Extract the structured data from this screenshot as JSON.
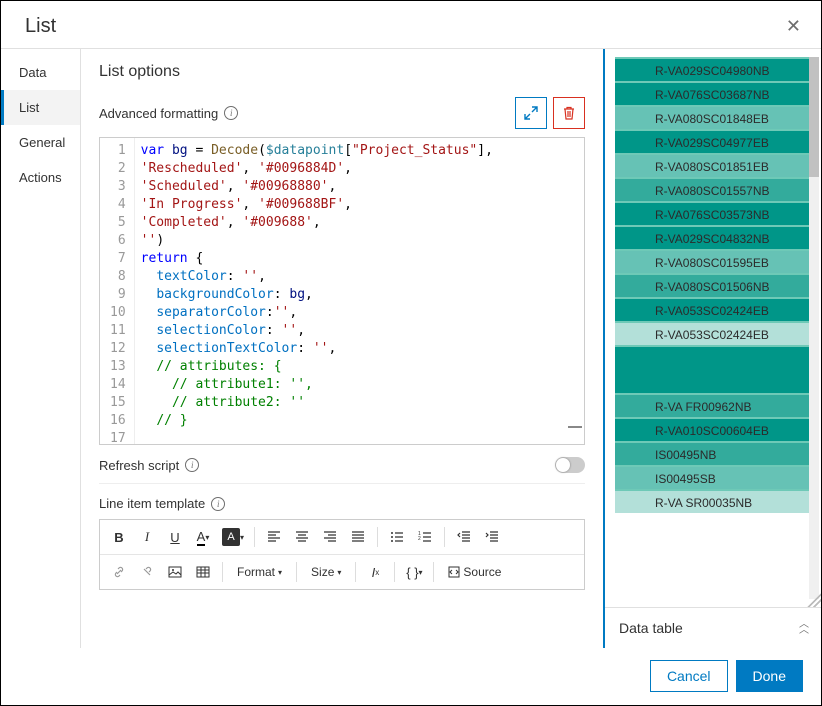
{
  "header": {
    "title": "List"
  },
  "sidebar": {
    "items": [
      {
        "label": "Data",
        "active": false
      },
      {
        "label": "List",
        "active": true
      },
      {
        "label": "General",
        "active": false
      },
      {
        "label": "Actions",
        "active": false
      }
    ]
  },
  "main": {
    "title": "List options",
    "advanced_label": "Advanced formatting",
    "refresh_label": "Refresh script",
    "refresh_on": false,
    "template_label": "Line item template",
    "toolbar": {
      "format_label": "Format",
      "size_label": "Size",
      "source_label": "Source"
    },
    "code": {
      "lines": [
        "var bg = Decode($datapoint[\"Project_Status\"],",
        "'Rescheduled', '#0096884D',",
        "'Scheduled', '#00968880',",
        "'In Progress', '#009688BF',",
        "'Completed', '#009688',",
        "'')",
        "",
        "return {",
        "  textColor: '',",
        "  backgroundColor: bg,",
        "  separatorColor:'',",
        "  selectionColor: '',",
        "  selectionTextColor: '',",
        "  // attributes: {",
        "    // attribute1: '',",
        "    // attribute2: ''",
        "  // }"
      ]
    }
  },
  "preview": {
    "data_table_label": "Data table",
    "items": [
      {
        "label": "R-VA029SC04980NB",
        "bg": "#009688"
      },
      {
        "label": "R-VA076SC03687NB",
        "bg": "#009688"
      },
      {
        "label": "R-VA080SC01848EB",
        "bg": "#66c2b5"
      },
      {
        "label": "R-VA029SC04977EB",
        "bg": "#009688"
      },
      {
        "label": "R-VA080SC01851EB",
        "bg": "#66c2b5"
      },
      {
        "label": "R-VA080SC01557NB",
        "bg": "#33ab9c"
      },
      {
        "label": "R-VA076SC03573NB",
        "bg": "#009688"
      },
      {
        "label": "R-VA029SC04832NB",
        "bg": "#009688"
      },
      {
        "label": "R-VA080SC01595EB",
        "bg": "#66c2b5"
      },
      {
        "label": "R-VA080SC01506NB",
        "bg": "#33ab9c"
      },
      {
        "label": "R-VA053SC02424EB",
        "bg": "#009688"
      },
      {
        "label": "R-VA053SC02424EB",
        "bg": "#b3e0d9"
      },
      {
        "label": "R-VA FR00962NB",
        "bg": "#33ab9c"
      },
      {
        "label": "R-VA010SC00604EB",
        "bg": "#009688"
      },
      {
        "label": "IS00495NB",
        "bg": "#33ab9c"
      },
      {
        "label": "IS00495SB",
        "bg": "#66c2b5"
      },
      {
        "label": "R-VA SR00035NB",
        "bg": "#b3e0d9"
      }
    ],
    "blank_pair_after_index": 11
  },
  "footer": {
    "cancel": "Cancel",
    "done": "Done"
  }
}
